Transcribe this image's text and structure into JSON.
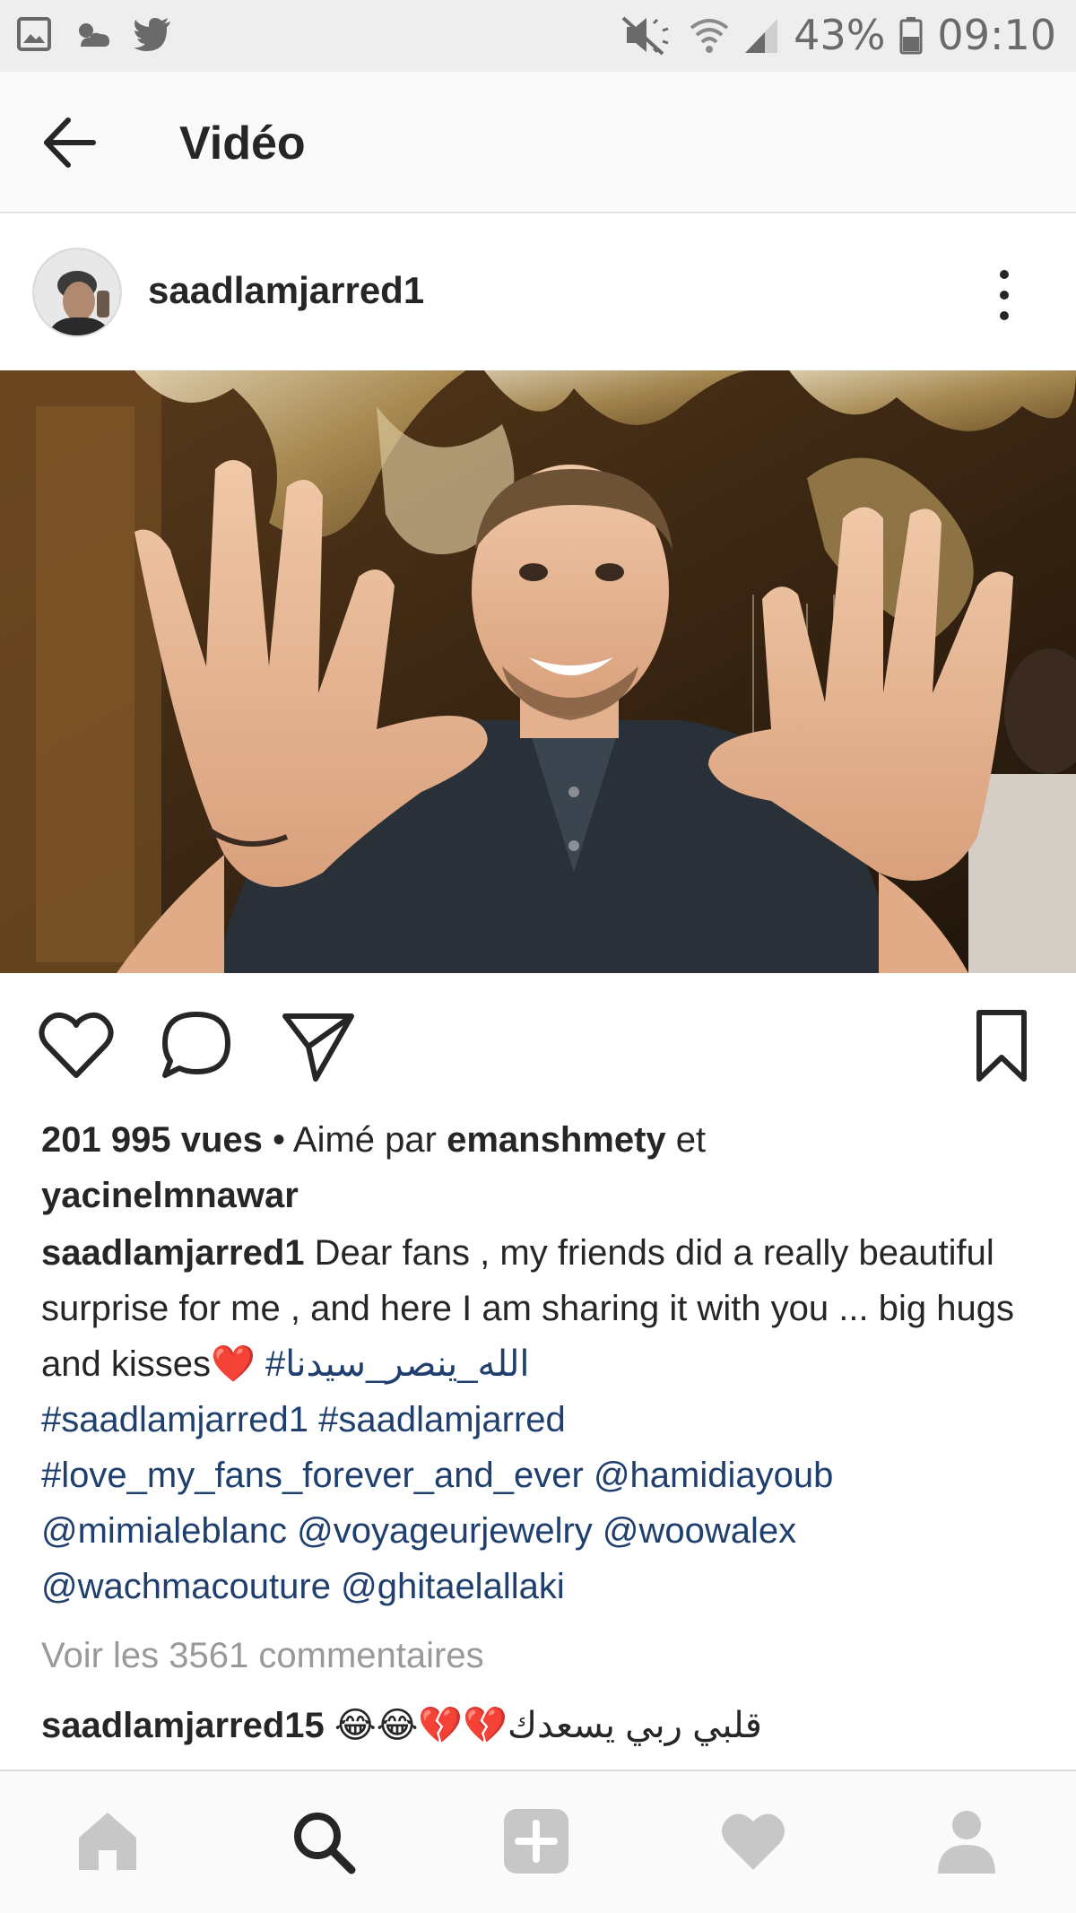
{
  "status_bar": {
    "battery_percent": "43%",
    "time": "09:10"
  },
  "header": {
    "title": "Vidéo"
  },
  "post": {
    "username": "saadlamjarred1",
    "views": "201 995 vues",
    "liked_by_prefix": " • Aimé par ",
    "liked_user_1": "emanshmety",
    "liked_and": " et",
    "liked_user_2": "yacinelmnawar",
    "caption_author": "saadlamjarred1",
    "caption_text": " Dear fans , my friends did a really beautiful surprise for me , and here I am sharing it with you ... big hugs and kisses",
    "caption_emoji": "❤️",
    "hashtag_arabic": "#الله_ينصر_سيدنا",
    "hashtag_1": "#saadlamjarred1",
    "hashtag_2": "#saadlamjarred",
    "hashtag_3": "#love_my_fans_forever_and_ever",
    "mention_1": "@hamidiayoub",
    "mention_2": "@mimialeblanc",
    "mention_3": "@voyageurjewelry",
    "mention_4": "@woowalex",
    "mention_5": "@wachmacouture",
    "mention_6": "@ghitaelallaki",
    "view_comments": "Voir les 3561 commentaires",
    "comment_user": "saadlamjarred15",
    "comment_emojis": "😂😂💔💔",
    "comment_text": "قلبي ربي يسعدك"
  },
  "icons": {
    "heart": "heart-icon",
    "comment": "comment-icon",
    "share": "share-icon",
    "bookmark": "bookmark-icon"
  }
}
